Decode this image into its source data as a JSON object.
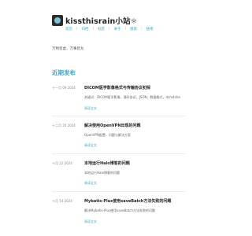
{
  "site": {
    "title": "kissthisrain小站☼",
    "nav": [
      "首页",
      "归档",
      "标签",
      "关于",
      "搜索",
      "链接"
    ],
    "motto": "万物皆虚，万事皆允"
  },
  "recent": {
    "heading": "近期发布",
    "posts": [
      {
        "date": "十一月 09 2024",
        "title": "DICOM医学影像格式与传输协议初探",
        "excerpt": "关键词：DICOM医学影像，通讯协议，JSON，数据格式，dcm4che",
        "more": "阅读全文"
      },
      {
        "date": "十二月 20 2024",
        "title": "解决使用OpenVPN出现的问题",
        "excerpt": "OpenVPN配置，问题与解决方案",
        "more": "阅读全文"
      },
      {
        "date": "十月 22 2024",
        "title": "本地运行Halo博客的问题",
        "excerpt": "本地运行Halo博客的问题",
        "more": "阅读全文"
      },
      {
        "date": "十月 14 2024",
        "title": "Mybatis-Plus使用saveBatch方法失败的问题",
        "excerpt": "解决Mybatis-Plus使用saveBatch方法失败的问题",
        "more": "阅读全文"
      }
    ]
  }
}
